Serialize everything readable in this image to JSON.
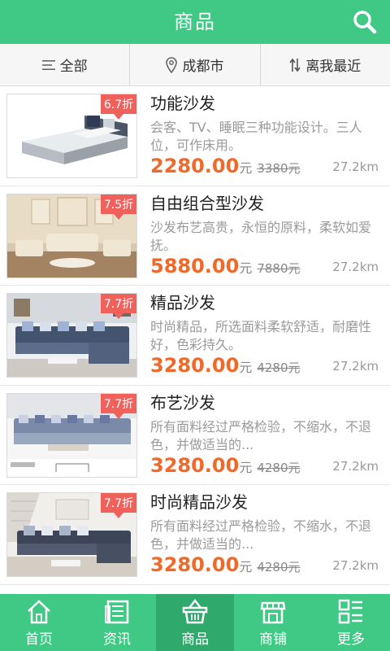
{
  "header": {
    "title": "商品",
    "search_icon": "search-icon"
  },
  "filters": [
    {
      "label": "全部",
      "icon": "menu-icon"
    },
    {
      "label": "成都市",
      "icon": "location-pin-icon"
    },
    {
      "label": "离我最近",
      "icon": "sort-icon"
    }
  ],
  "products": [
    {
      "name": "功能沙发",
      "desc": "会客、TV、睡眠三种功能设计。三人位，可作床用。",
      "price": "2280.00",
      "unit": "元",
      "old_price": "3380元",
      "distance": "27.2km",
      "discount": "6.7折"
    },
    {
      "name": "自由组合型沙发",
      "desc": "沙发布艺高贵，永恒的原料，柔软如爱抚。",
      "price": "5880.00",
      "unit": "元",
      "old_price": "7880元",
      "distance": "27.2km",
      "discount": "7.5折"
    },
    {
      "name": "精品沙发",
      "desc": "时尚精品，所选面料柔软舒适，耐磨性好，色彩持久。",
      "price": "3280.00",
      "unit": "元",
      "old_price": "4280元",
      "distance": "27.2km",
      "discount": "7.7折"
    },
    {
      "name": "布艺沙发",
      "desc": "所有面料经过严格检验，不缩水，不退色，并做适当的...",
      "price": "3280.00",
      "unit": "元",
      "old_price": "4280元",
      "distance": "27.2km",
      "discount": "7.7折"
    },
    {
      "name": "时尚精品沙发",
      "desc": "所有面料经过严格检验，不缩水，不退色，并做适当的...",
      "price": "3280.00",
      "unit": "元",
      "old_price": "4280元",
      "distance": "27.2km",
      "discount": "7.7折"
    }
  ],
  "tabs": [
    {
      "label": "首页",
      "icon": "home-icon"
    },
    {
      "label": "资讯",
      "icon": "news-icon"
    },
    {
      "label": "商品",
      "icon": "basket-icon",
      "active": true
    },
    {
      "label": "商铺",
      "icon": "store-icon"
    },
    {
      "label": "更多",
      "icon": "more-grid-icon"
    }
  ],
  "colors": {
    "primary": "#3fc984",
    "active_tab": "#2fa96c",
    "price": "#ef6a2a",
    "badge": "#f0615c"
  }
}
